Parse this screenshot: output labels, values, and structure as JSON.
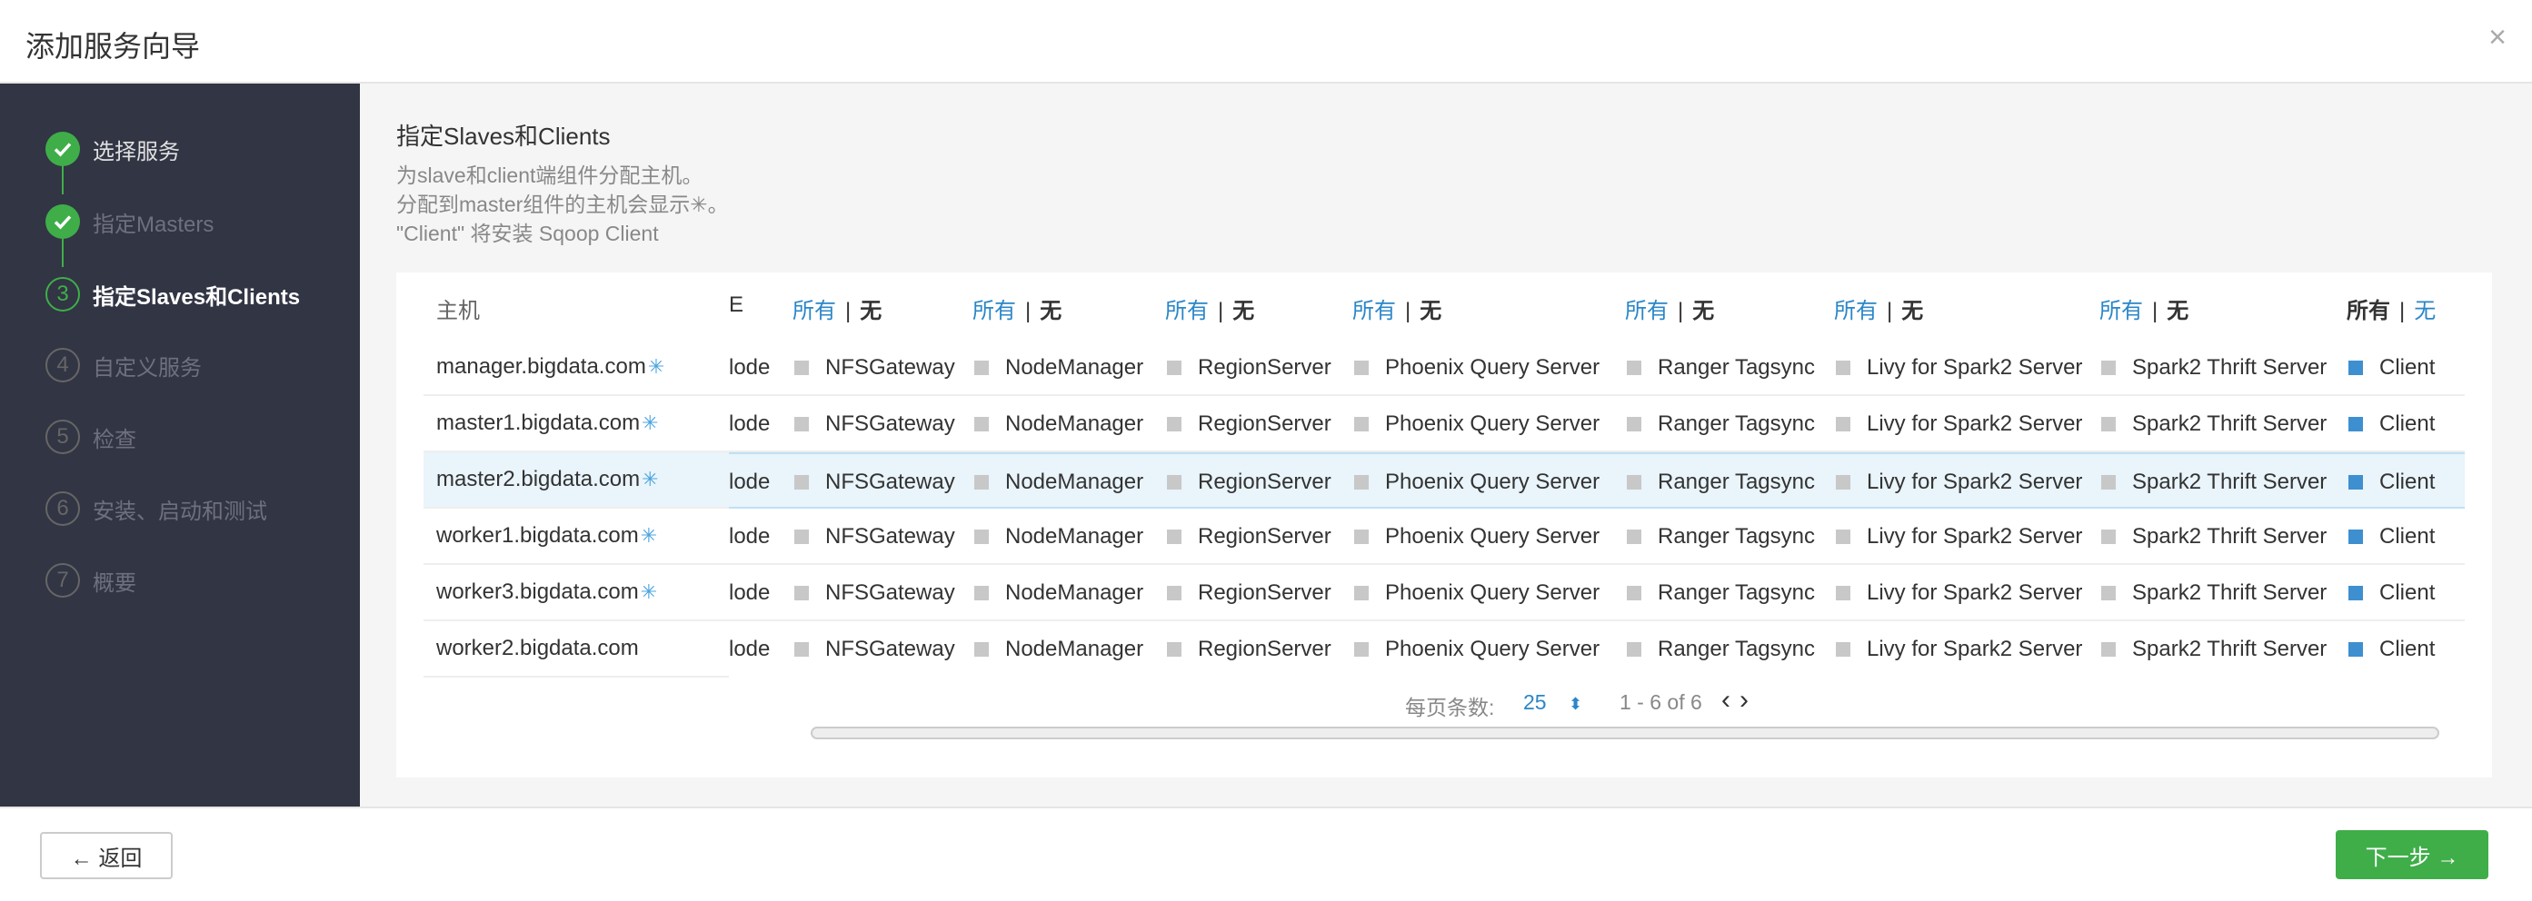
{
  "window": {
    "title": "添加服务向导",
    "close_glyph": "×"
  },
  "steps": [
    {
      "num": "1",
      "label": "选择服务",
      "state": "done"
    },
    {
      "num": "2",
      "label": "指定Masters",
      "state": "done-faded"
    },
    {
      "num": "3",
      "label": "指定Slaves和Clients",
      "state": "current"
    },
    {
      "num": "4",
      "label": "自定义服务",
      "state": "todo"
    },
    {
      "num": "5",
      "label": "检查",
      "state": "todo"
    },
    {
      "num": "6",
      "label": "安装、启动和测试",
      "state": "todo"
    },
    {
      "num": "7",
      "label": "概要",
      "state": "todo"
    }
  ],
  "main": {
    "title": "指定Slaves和Clients",
    "desc1": "为slave和client端组件分配主机。",
    "desc2": "分配到master组件的主机会显示✳。",
    "desc3": "\"Client\" 将安装 Sqoop Client"
  },
  "table": {
    "host_header": "主机",
    "partial_header": "E",
    "all_label": "所有",
    "none_label": "无",
    "sep": "|",
    "partial_cell": "lode",
    "columns": [
      "NFSGateway",
      "NodeManager",
      "RegionServer",
      "Phoenix Query Server",
      "Ranger Tagsync",
      "Livy for Spark2 Server",
      "Spark2 Thrift Server",
      "Client"
    ],
    "rows": [
      {
        "host": "manager.bigdata.com",
        "star": "✳"
      },
      {
        "host": "master1.bigdata.com",
        "star": "✳"
      },
      {
        "host": "master2.bigdata.com",
        "star": "✳"
      },
      {
        "host": "worker1.bigdata.com",
        "star": "✳"
      },
      {
        "host": "worker3.bigdata.com",
        "star": "✳"
      },
      {
        "host": "worker2.bigdata.com",
        "star": ""
      }
    ],
    "selected_row": 2,
    "client_checked": true
  },
  "pager": {
    "per_page_label": "每页条数:",
    "per_page_value": "25",
    "range": "1 - 6 of 6",
    "prev": "‹",
    "next": "›"
  },
  "footer": {
    "back_label": "← 返回",
    "next_label": "下一步 →"
  },
  "colors": {
    "accent_green": "#3fae49",
    "link_blue": "#2a86c8",
    "sidebar_bg": "#323544"
  }
}
